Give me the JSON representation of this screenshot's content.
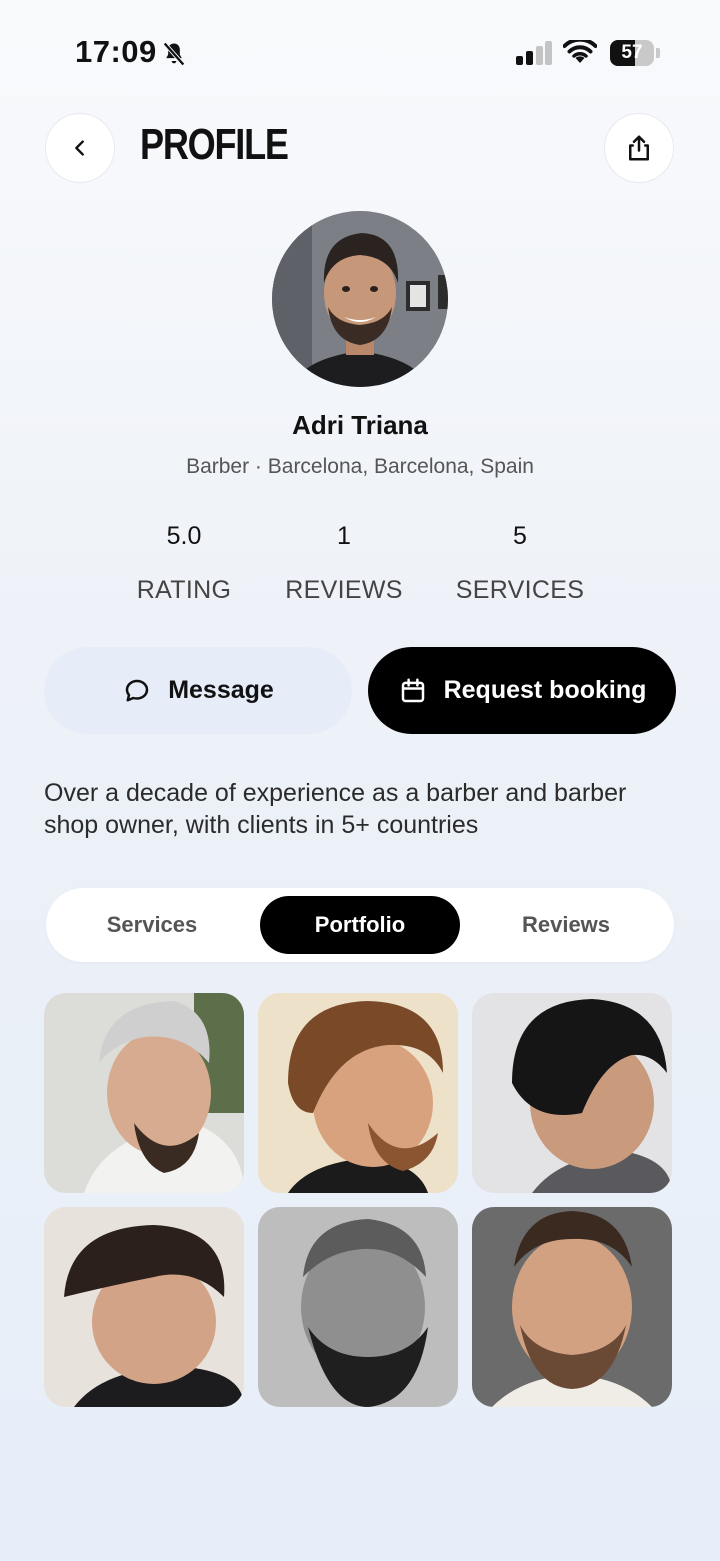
{
  "status_bar": {
    "time": "17:09",
    "battery": "57",
    "battery_level": 0.57
  },
  "header": {
    "title": "PROFILE"
  },
  "profile": {
    "name": "Adri Triana",
    "subtitle": "Barber · Barcelona, Barcelona, Spain",
    "bio": "Over a decade of experience as a barber and barber shop owner, with clients in 5+ countries"
  },
  "stats": [
    {
      "value": "5.0",
      "label": "RATING"
    },
    {
      "value": "1",
      "label": "REVIEWS"
    },
    {
      "value": "5",
      "label": "SERVICES"
    }
  ],
  "actions": {
    "message": "Message",
    "booking": "Request booking"
  },
  "tabs": [
    {
      "label": "Services",
      "active": false
    },
    {
      "label": "Portfolio",
      "active": true
    },
    {
      "label": "Reviews",
      "active": false
    }
  ],
  "colors": {
    "accent": "#000000",
    "message_bg": "#e6edf8"
  },
  "icons": {
    "back": "chevron-left-icon",
    "share": "share-icon",
    "message": "chat-bubble-icon",
    "booking": "calendar-icon",
    "bell": "bell-slash-icon"
  }
}
